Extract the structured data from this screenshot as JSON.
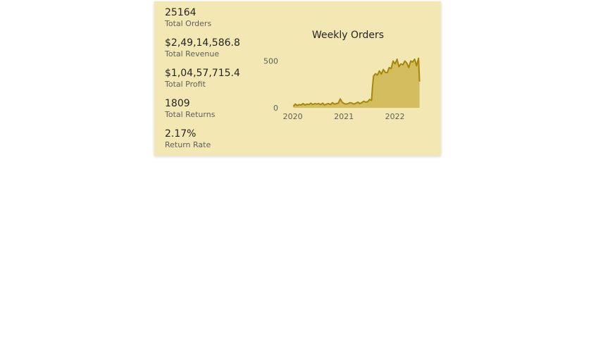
{
  "kpis": [
    {
      "value": "25164",
      "label": "Total Orders"
    },
    {
      "value": "$2,49,14,586.8",
      "label": "Total Revenue"
    },
    {
      "value": "$1,04,57,715.4",
      "label": "Total Profit"
    },
    {
      "value": "1809",
      "label": "Total Returns"
    },
    {
      "value": "2.17%",
      "label": "Return Rate"
    }
  ],
  "colors": {
    "card_background": "#f3e8b3",
    "area_fill": "#d4bd5e",
    "line": "#a7860c"
  },
  "chart_data": {
    "type": "area",
    "title": "Weekly Orders",
    "xlabel": "",
    "ylabel": "",
    "x_ticks": [
      "2020",
      "2021",
      "2022"
    ],
    "y_ticks": [
      0,
      500
    ],
    "xlim": [
      "2019-12-29",
      "2022-07-03"
    ],
    "ylim": [
      0,
      550
    ],
    "grid": false,
    "series": [
      {
        "x": [
          "2020-01-05",
          "2020-01-19",
          "2020-02-02",
          "2020-02-16",
          "2020-03-01",
          "2020-03-15",
          "2020-03-29",
          "2020-04-12",
          "2020-04-26",
          "2020-05-10",
          "2020-05-24",
          "2020-06-07",
          "2020-06-21",
          "2020-07-05",
          "2020-07-19",
          "2020-08-02",
          "2020-08-16",
          "2020-08-30",
          "2020-09-13",
          "2020-09-27",
          "2020-10-11",
          "2020-10-25",
          "2020-11-08",
          "2020-11-22",
          "2020-12-06",
          "2020-12-20",
          "2021-01-03",
          "2021-01-17",
          "2021-01-31",
          "2021-02-14",
          "2021-02-28",
          "2021-03-14",
          "2021-03-28",
          "2021-04-11",
          "2021-04-25",
          "2021-05-09",
          "2021-05-23",
          "2021-06-06",
          "2021-06-20",
          "2021-07-04",
          "2021-07-18",
          "2021-07-25",
          "2021-08-01",
          "2021-08-15",
          "2021-08-29",
          "2021-09-12",
          "2021-09-26",
          "2021-10-10",
          "2021-10-24",
          "2021-11-07",
          "2021-11-21",
          "2021-12-05",
          "2021-12-19",
          "2022-01-02",
          "2022-01-16",
          "2022-01-30",
          "2022-02-13",
          "2022-02-27",
          "2022-03-13",
          "2022-03-27",
          "2022-04-10",
          "2022-04-24",
          "2022-05-08",
          "2022-05-22",
          "2022-06-05",
          "2022-06-19",
          "2022-06-26"
        ],
        "values": [
          15,
          40,
          25,
          35,
          30,
          45,
          30,
          40,
          35,
          50,
          35,
          45,
          40,
          45,
          35,
          50,
          30,
          40,
          45,
          35,
          55,
          40,
          45,
          50,
          95,
          60,
          45,
          40,
          45,
          55,
          50,
          40,
          50,
          60,
          45,
          55,
          70,
          60,
          65,
          90,
          80,
          230,
          340,
          365,
          350,
          395,
          360,
          410,
          380,
          375,
          430,
          420,
          500,
          470,
          520,
          440,
          470,
          460,
          500,
          480,
          430,
          500,
          490,
          520,
          450,
          530,
          280
        ]
      }
    ]
  }
}
